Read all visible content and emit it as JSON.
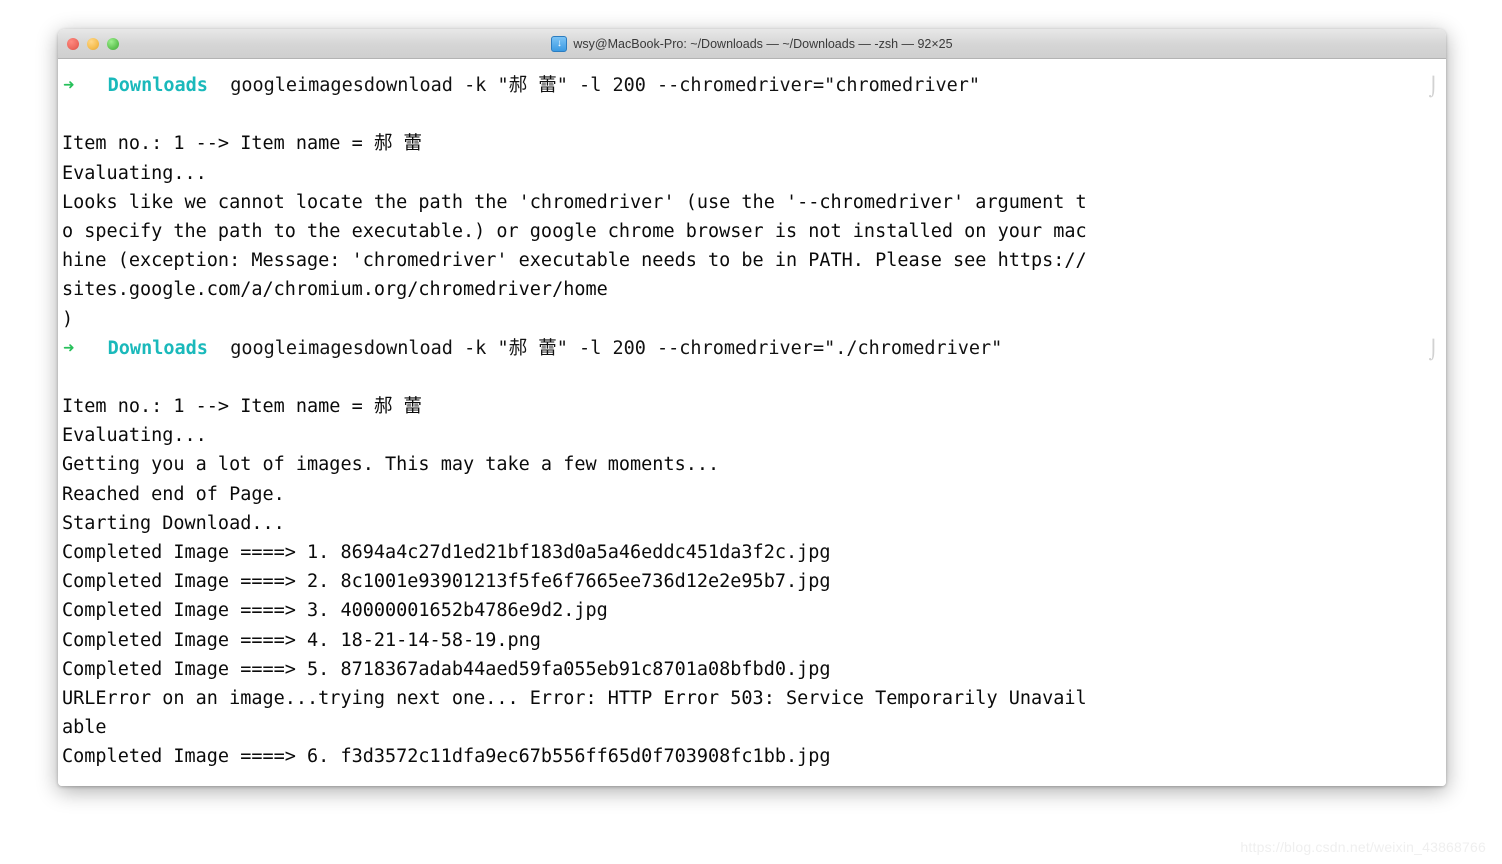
{
  "window": {
    "title": "wsy@MacBook-Pro: ~/Downloads — ~/Downloads — -zsh — 92×25",
    "title_icon": "download-arrow-icon",
    "traffic_lights": {
      "close_label": "",
      "minimize_label": "",
      "maximize_label": ""
    },
    "colors": {
      "titlebar_top": "#e8e8e8",
      "titlebar_bottom": "#cfcfcf",
      "close": "#ed6a5f",
      "minimize": "#f5bd4f",
      "maximize": "#62c554",
      "background": "#ffffff",
      "foreground": "#0a0a0a",
      "prompt_arrow": "#27c05a",
      "prompt_cwd": "#1ab9bb"
    }
  },
  "shell": {
    "prompt_arrow": "➜",
    "prompt_cwd": "Downloads",
    "right_marker": "⌡"
  },
  "terminal": {
    "lines": [
      {
        "type": "prompt",
        "arrow": "➜",
        "cwd": "Downloads",
        "command": "googleimagesdownload -k \"郝 蕾\" -l 200 --chromedriver=\"chromedriver\"",
        "right_marker": "⌡"
      },
      {
        "type": "blank",
        "text": ""
      },
      {
        "type": "output",
        "text": "Item no.: 1 --> Item name = 郝 蕾"
      },
      {
        "type": "output",
        "text": "Evaluating..."
      },
      {
        "type": "output",
        "text": "Looks like we cannot locate the path the 'chromedriver' (use the '--chromedriver' argument t"
      },
      {
        "type": "output",
        "text": "o specify the path to the executable.) or google chrome browser is not installed on your mac"
      },
      {
        "type": "output",
        "text": "hine (exception: Message: 'chromedriver' executable needs to be in PATH. Please see https://"
      },
      {
        "type": "output",
        "text": "sites.google.com/a/chromium.org/chromedriver/home"
      },
      {
        "type": "output",
        "text": ")"
      },
      {
        "type": "prompt",
        "arrow": "➜",
        "cwd": "Downloads",
        "command": "googleimagesdownload -k \"郝 蕾\" -l 200 --chromedriver=\"./chromedriver\"",
        "right_marker": "⌡"
      },
      {
        "type": "blank",
        "text": ""
      },
      {
        "type": "output",
        "text": "Item no.: 1 --> Item name = 郝 蕾"
      },
      {
        "type": "output",
        "text": "Evaluating..."
      },
      {
        "type": "output",
        "text": "Getting you a lot of images. This may take a few moments..."
      },
      {
        "type": "output",
        "text": "Reached end of Page."
      },
      {
        "type": "output",
        "text": "Starting Download..."
      },
      {
        "type": "output",
        "text": "Completed Image ====> 1. 8694a4c27d1ed21bf183d0a5a46eddc451da3f2c.jpg"
      },
      {
        "type": "output",
        "text": "Completed Image ====> 2. 8c1001e93901213f5fe6f7665ee736d12e2e95b7.jpg"
      },
      {
        "type": "output",
        "text": "Completed Image ====> 3. 40000001652b4786e9d2.jpg"
      },
      {
        "type": "output",
        "text": "Completed Image ====> 4. 18-21-14-58-19.png"
      },
      {
        "type": "output",
        "text": "Completed Image ====> 5. 8718367adab44aed59fa055eb91c8701a08bfbd0.jpg"
      },
      {
        "type": "output",
        "text": "URLError on an image...trying next one... Error: HTTP Error 503: Service Temporarily Unavail"
      },
      {
        "type": "output",
        "text": "able"
      },
      {
        "type": "output",
        "text": "Completed Image ====> 6. f3d3572c11dfa9ec67b556ff65d0f703908fc1bb.jpg"
      }
    ]
  },
  "watermark": {
    "text": "https://blog.csdn.net/weixin_43868766"
  }
}
